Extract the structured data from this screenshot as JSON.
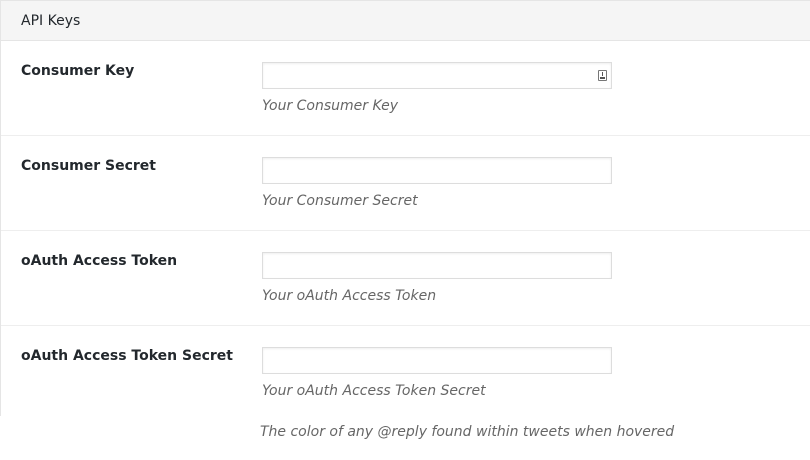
{
  "panel": {
    "title": "API Keys"
  },
  "fields": [
    {
      "label": "Consumer Key",
      "value": "",
      "description": "Your Consumer Key",
      "has_autofill_icon": true
    },
    {
      "label": "Consumer Secret",
      "value": "",
      "description": "Your Consumer Secret"
    },
    {
      "label": "oAuth Access Token",
      "value": "",
      "description": "Your oAuth Access Token"
    },
    {
      "label": "oAuth Access Token Secret",
      "value": "",
      "description": "Your oAuth Access Token Secret"
    }
  ],
  "footer_hint": "The color of any @reply found within tweets when hovered",
  "icons": {
    "autofill": "autofill-key-icon"
  }
}
